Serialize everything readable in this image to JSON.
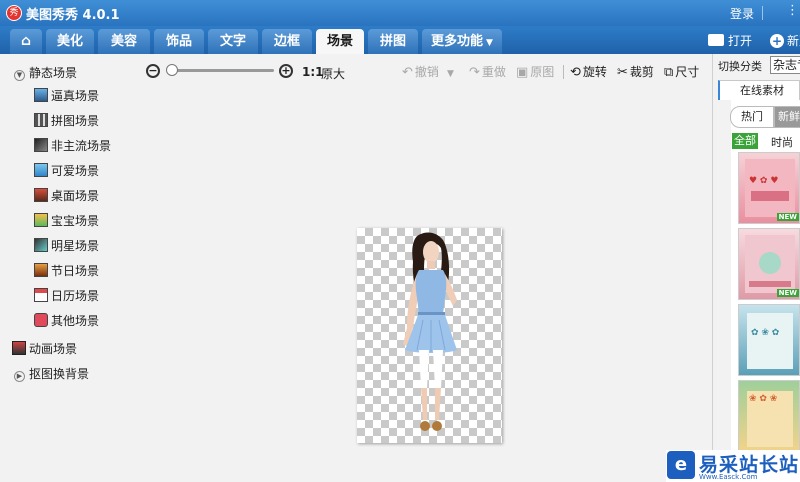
{
  "app": {
    "title": "美图秀秀 4.0.1",
    "logo_text": "秀",
    "login": "登录",
    "menu_glyph": "⋮"
  },
  "tabs": [
    {
      "label": "美化"
    },
    {
      "label": "美容"
    },
    {
      "label": "饰品"
    },
    {
      "label": "文字"
    },
    {
      "label": "边框"
    },
    {
      "label": "场景"
    },
    {
      "label": "拼图"
    },
    {
      "label": "更多功能"
    }
  ],
  "active_tab": "场景",
  "actions": {
    "open": "打开",
    "new": "新建"
  },
  "sidebar": {
    "static_group": "静态场景",
    "items": [
      {
        "label": "逼真场景"
      },
      {
        "label": "拼图场景"
      },
      {
        "label": "非主流场景"
      },
      {
        "label": "可爱场景"
      },
      {
        "label": "桌面场景"
      },
      {
        "label": "宝宝场景"
      },
      {
        "label": "明星场景"
      },
      {
        "label": "节日场景"
      },
      {
        "label": "日历场景"
      },
      {
        "label": "其他场景"
      }
    ],
    "animated_group": "动画场景",
    "cutout_group": "抠图换背景"
  },
  "toolbar": {
    "zoom_ratio": "1:1",
    "original_size": "原大",
    "undo": "撤销",
    "redo": "重做",
    "original": "原图",
    "rotate": "旋转",
    "crop": "裁剪",
    "resize": "尺寸",
    "zoom_level": 0.0
  },
  "right_panel": {
    "category_label": "切换分类",
    "category_value": "杂志专题",
    "online_tab": "在线素材",
    "hot": "热门",
    "new": "新鲜",
    "all": "全部",
    "fashion": "时尚gi",
    "new_badge": "NEW"
  },
  "watermark": {
    "text": "易采站长站",
    "url": "Www.Easck.Com",
    "logo": "e"
  },
  "colors": {
    "title_bar": "#2a73bf",
    "tab_active": "#f7f7f7",
    "badge_green": "#3aa33a",
    "watermark_blue": "#1d5fbf"
  }
}
